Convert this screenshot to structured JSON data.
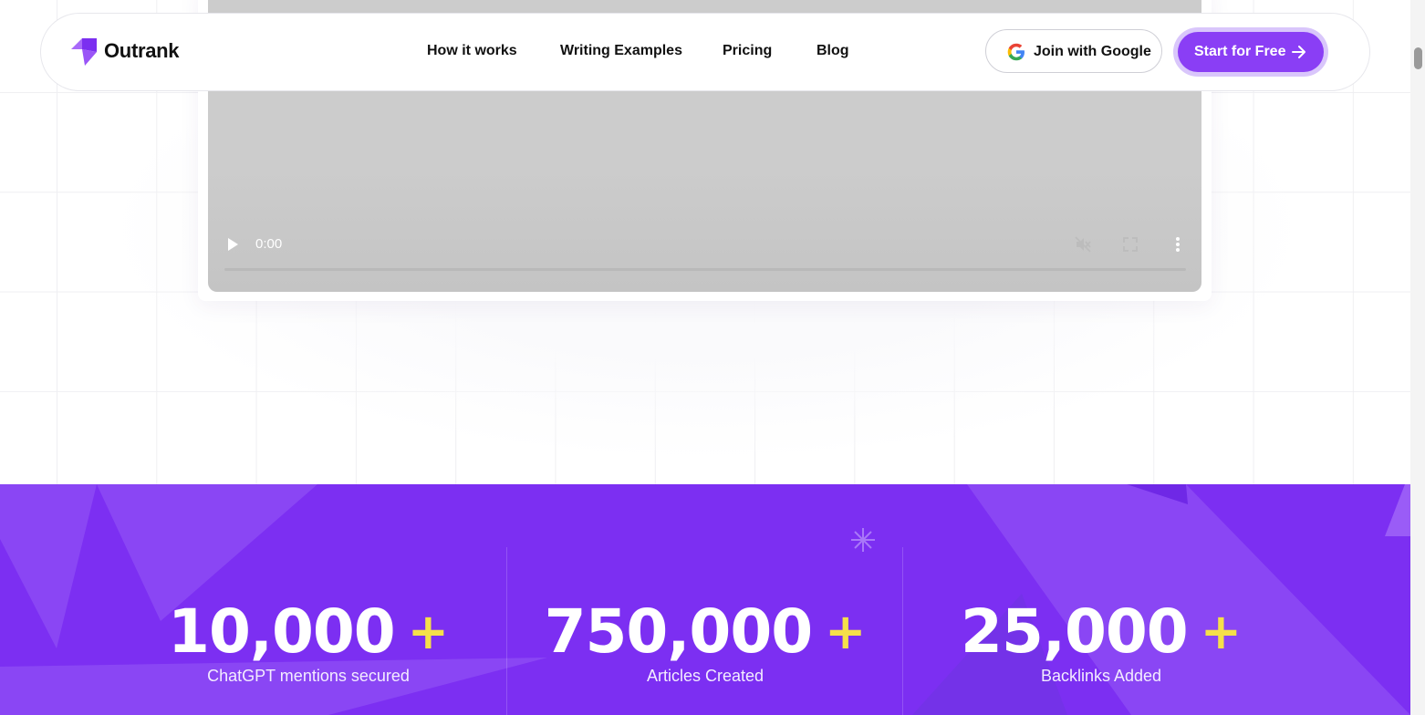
{
  "brand": {
    "name": "Outrank"
  },
  "nav": {
    "links": [
      {
        "label": "How it works"
      },
      {
        "label": "Writing Examples"
      },
      {
        "label": "Pricing"
      },
      {
        "label": "Blog"
      }
    ],
    "google_label": "Join with Google",
    "cta_label": "Start for Free"
  },
  "video": {
    "time": "0:00",
    "progress": 0
  },
  "stats": [
    {
      "value": "10,000",
      "suffix": "+",
      "caption": "ChatGPT mentions secured"
    },
    {
      "value": "750,000",
      "suffix": "+",
      "caption": "Articles Created"
    },
    {
      "value": "25,000",
      "suffix": "+",
      "caption": "Backlinks Added"
    }
  ],
  "colors": {
    "accent": "#8a3ef5",
    "stats_background": "#7c2ff2",
    "plus": "#f5e04a"
  },
  "icons": [
    "logo-icon",
    "google-icon",
    "arrow-right-icon",
    "play-icon",
    "mute-icon",
    "fullscreen-icon",
    "more-options-icon",
    "sparkle-icon"
  ]
}
